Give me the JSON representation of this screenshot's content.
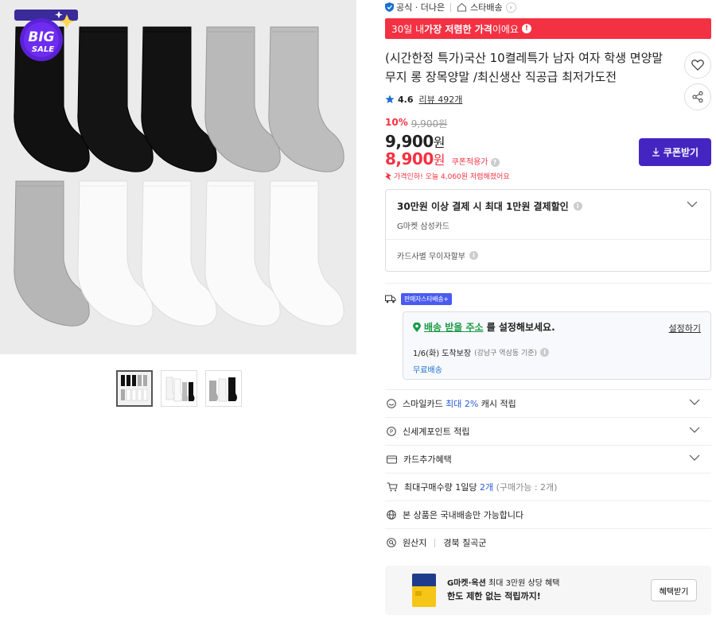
{
  "seller": {
    "official_label": "공식 · 더나은",
    "store_label": "스타배송"
  },
  "banner": {
    "prefix": "30일 내 ",
    "emphasis": "가장 저렴한 가격",
    "suffix": "이에요"
  },
  "product": {
    "title": "(시간한정 특가)국산 10켤레특가 남자 여자 학생 면양말 무지 롱 장목양말 /최신생산 직공급 최저가도전",
    "rating": "4.6",
    "review_label": "리뷰 492개"
  },
  "price": {
    "discount_pct": "10%",
    "original": "9,900원",
    "sale_value": "9,900",
    "won": "원",
    "coupon_value": "8,900",
    "coupon_tag": "쿠폰적용가",
    "save_note": "가격인하! 오늘 4,060원 저렴해졌어요",
    "coupon_button": "쿠폰받기"
  },
  "card_benefit": {
    "headline": "30만원 이상 결제 시 최대 1만원 결제할인",
    "sub": "G마켓 삼성카드",
    "installment": "카드사별 무이자할부"
  },
  "shipping": {
    "badge": "판매자스타배송+",
    "address_link": "배송 받을 주소",
    "address_suffix": "를 설정해보세요.",
    "set_link": "설정하기",
    "eta_main": "1/6(화) 도착보장",
    "eta_small": "(강남구 역삼동 기준)",
    "free": "무료배송"
  },
  "benefits": {
    "smile_prefix": "스마일카드 ",
    "smile_highlight": "최대 2%",
    "smile_suffix": " 캐시 적립",
    "shinsegae": "신세계포인트 적립",
    "card_extra": "카드추가혜택",
    "max_qty_prefix": "최대구매수량 1일당 ",
    "max_qty_highlight": "2개",
    "max_qty_suffix": " (구매가능 : 2개)",
    "domestic": "본 상품은 국내배송만 가능합니다",
    "origin_label": "원산지",
    "origin_value": "경북 칠곡군"
  },
  "promo": {
    "brand": "G마켓·옥션",
    "line1_rest": " 최대 3만원 상당 혜택",
    "line2": "한도 제한 없는 적립까지!",
    "button": "혜택받기"
  },
  "gallery": {
    "sale_badge_top": "BIG",
    "sale_badge_bottom": "SALE"
  },
  "colors": {
    "accent_red": "#f43142",
    "coupon_purple": "#4525c1",
    "ship_green": "#1a9a44",
    "link_blue": "#2a5bd7"
  }
}
